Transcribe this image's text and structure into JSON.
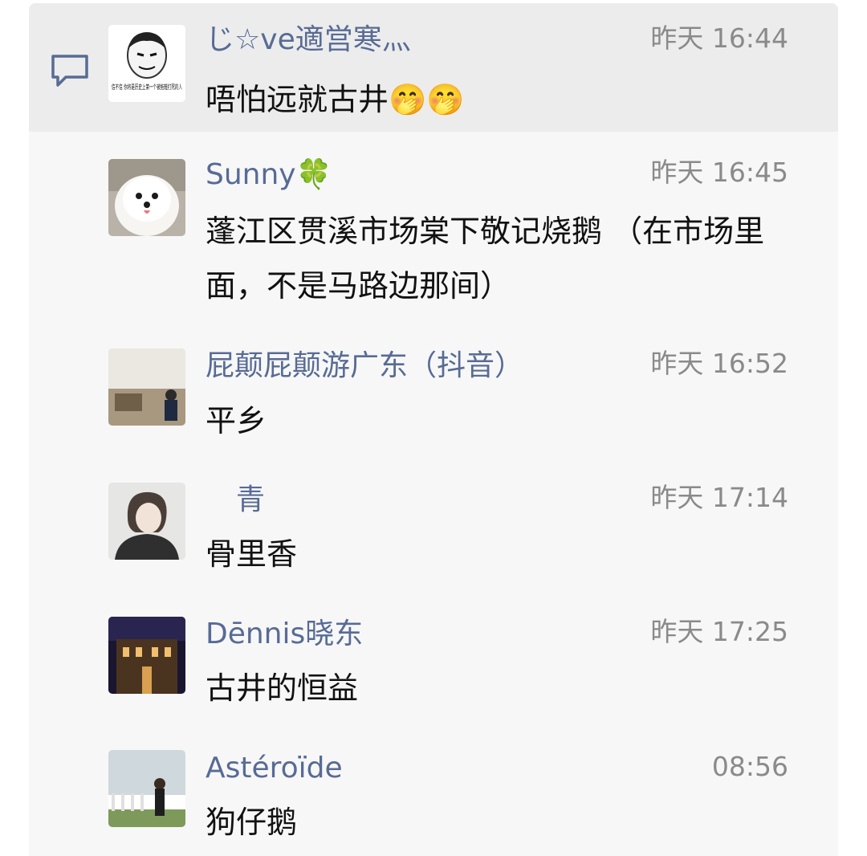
{
  "comments": [
    {
      "name": "じ☆ve適営寒灬",
      "time": "昨天 16:44",
      "text": "唔怕远就古井🤭🤭",
      "avatar_caption": "信不信 你将是历史上第一个被拖鞋打死的人"
    },
    {
      "name": "Sunny🍀",
      "time": "昨天 16:45",
      "text": "蓬江区贯溪市场棠下敬记烧鹅 （在市场里面，不是马路边那间）"
    },
    {
      "name": "屁颠屁颠游广东（抖音）",
      "time": "昨天 16:52",
      "text": "平乡"
    },
    {
      "name": "青",
      "time": "昨天 17:14",
      "text": "骨里香"
    },
    {
      "name": "Dēnnis晓东",
      "time": "昨天 17:25",
      "text": "古井的恒益"
    },
    {
      "name": "Astéroïde",
      "time": "08:56",
      "text": "狗仔鹅"
    }
  ],
  "colors": {
    "name": "#576b95",
    "time": "#8a8a8a",
    "text": "#111111",
    "panel": "#f7f7f7",
    "highlight": "#ececec"
  }
}
